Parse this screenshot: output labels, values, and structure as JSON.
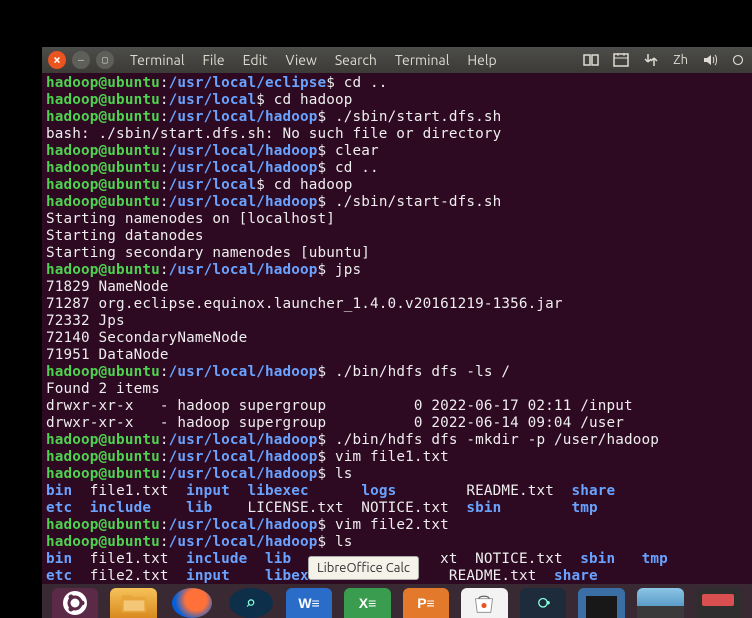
{
  "menu": {
    "terminal1": "Terminal",
    "file": "File",
    "edit": "Edit",
    "view": "View",
    "search": "Search",
    "terminal2": "Terminal",
    "help": "Help"
  },
  "tray": {
    "lang": "Zh"
  },
  "tooltip": "LibreOffice Calc",
  "lines": [
    {
      "t": "p",
      "u": "hadoop@ubuntu",
      "c": ":",
      "p": "/usr/local/eclipse",
      "d": "$ ",
      "r": "cd .."
    },
    {
      "t": "p",
      "u": "hadoop@ubuntu",
      "c": ":",
      "p": "/usr/local",
      "d": "$ ",
      "r": "cd hadoop"
    },
    {
      "t": "p",
      "u": "hadoop@ubuntu",
      "c": ":",
      "p": "/usr/local/hadoop",
      "d": "$ ",
      "r": "./sbin/start.dfs.sh"
    },
    {
      "t": "o",
      "r": "bash: ./sbin/start.dfs.sh: No such file or directory"
    },
    {
      "t": "p",
      "u": "hadoop@ubuntu",
      "c": ":",
      "p": "/usr/local/hadoop",
      "d": "$ ",
      "r": "clear"
    },
    {
      "t": "p",
      "u": "hadoop@ubuntu",
      "c": ":",
      "p": "/usr/local/hadoop",
      "d": "$ ",
      "r": "cd .."
    },
    {
      "t": "p",
      "u": "hadoop@ubuntu",
      "c": ":",
      "p": "/usr/local",
      "d": "$ ",
      "r": "cd hadoop"
    },
    {
      "t": "p",
      "u": "hadoop@ubuntu",
      "c": ":",
      "p": "/usr/local/hadoop",
      "d": "$ ",
      "r": "./sbin/start-dfs.sh"
    },
    {
      "t": "o",
      "r": "Starting namenodes on [localhost]"
    },
    {
      "t": "o",
      "r": "Starting datanodes"
    },
    {
      "t": "o",
      "r": "Starting secondary namenodes [ubuntu]"
    },
    {
      "t": "p",
      "u": "hadoop@ubuntu",
      "c": ":",
      "p": "/usr/local/hadoop",
      "d": "$ ",
      "r": "jps"
    },
    {
      "t": "o",
      "r": "71829 NameNode"
    },
    {
      "t": "o",
      "r": "71287 org.eclipse.equinox.launcher_1.4.0.v20161219-1356.jar"
    },
    {
      "t": "o",
      "r": "72332 Jps"
    },
    {
      "t": "o",
      "r": "72140 SecondaryNameNode"
    },
    {
      "t": "o",
      "r": "71951 DataNode"
    },
    {
      "t": "p",
      "u": "hadoop@ubuntu",
      "c": ":",
      "p": "/usr/local/hadoop",
      "d": "$ ",
      "r": "./bin/hdfs dfs -ls /"
    },
    {
      "t": "o",
      "r": "Found 2 items"
    },
    {
      "t": "o",
      "r": "drwxr-xr-x   - hadoop supergroup          0 2022-06-17 02:11 /input"
    },
    {
      "t": "o",
      "r": "drwxr-xr-x   - hadoop supergroup          0 2022-06-14 09:04 /user"
    },
    {
      "t": "p",
      "u": "hadoop@ubuntu",
      "c": ":",
      "p": "/usr/local/hadoop",
      "d": "$ ",
      "r": "./bin/hdfs dfs -mkdir -p /user/hadoop"
    },
    {
      "t": "p",
      "u": "hadoop@ubuntu",
      "c": ":",
      "p": "/usr/local/hadoop",
      "d": "$ ",
      "r": "vim file1.txt"
    },
    {
      "t": "p",
      "u": "hadoop@ubuntu",
      "c": ":",
      "p": "/usr/local/hadoop",
      "d": "$ ",
      "r": "ls"
    },
    {
      "t": "ls",
      "cols": [
        [
          "bin",
          "blu"
        ],
        [
          "  file1.txt  ",
          "wht"
        ],
        [
          "input",
          "blu"
        ],
        [
          "  ",
          "wht"
        ],
        [
          "libexec",
          "blu"
        ],
        [
          "      ",
          "wht"
        ],
        [
          "logs",
          "blu"
        ],
        [
          "        README.txt  ",
          "wht"
        ],
        [
          "share",
          "blu"
        ]
      ]
    },
    {
      "t": "ls",
      "cols": [
        [
          "etc",
          "blu"
        ],
        [
          "  ",
          "wht"
        ],
        [
          "include",
          "blu"
        ],
        [
          "    ",
          "wht"
        ],
        [
          "lib",
          "blu"
        ],
        [
          "    LICENSE.txt  NOTICE.txt  ",
          "wht"
        ],
        [
          "sbin",
          "blu"
        ],
        [
          "        ",
          "wht"
        ],
        [
          "tmp",
          "blu"
        ]
      ]
    },
    {
      "t": "p",
      "u": "hadoop@ubuntu",
      "c": ":",
      "p": "/usr/local/hadoop",
      "d": "$ ",
      "r": "vim file2.txt"
    },
    {
      "t": "p",
      "u": "hadoop@ubuntu",
      "c": ":",
      "p": "/usr/local/hadoop",
      "d": "$ ",
      "r": "ls"
    },
    {
      "t": "ls",
      "cols": [
        [
          "bin",
          "blu"
        ],
        [
          "  file1.txt  ",
          "wht"
        ],
        [
          "include",
          "blu"
        ],
        [
          "  ",
          "wht"
        ],
        [
          "lib",
          "blu"
        ],
        [
          "                 xt  NOTICE.txt  ",
          "wht"
        ],
        [
          "sbin",
          "blu"
        ],
        [
          "   ",
          "wht"
        ],
        [
          "tmp",
          "blu"
        ]
      ]
    },
    {
      "t": "ls",
      "cols": [
        [
          "etc",
          "blu"
        ],
        [
          "  file2.txt  ",
          "wht"
        ],
        [
          "input",
          "blu"
        ],
        [
          "    ",
          "wht"
        ],
        [
          "libexec",
          "blu"
        ],
        [
          "              README.txt  ",
          "wht"
        ],
        [
          "share",
          "blu"
        ]
      ]
    }
  ]
}
